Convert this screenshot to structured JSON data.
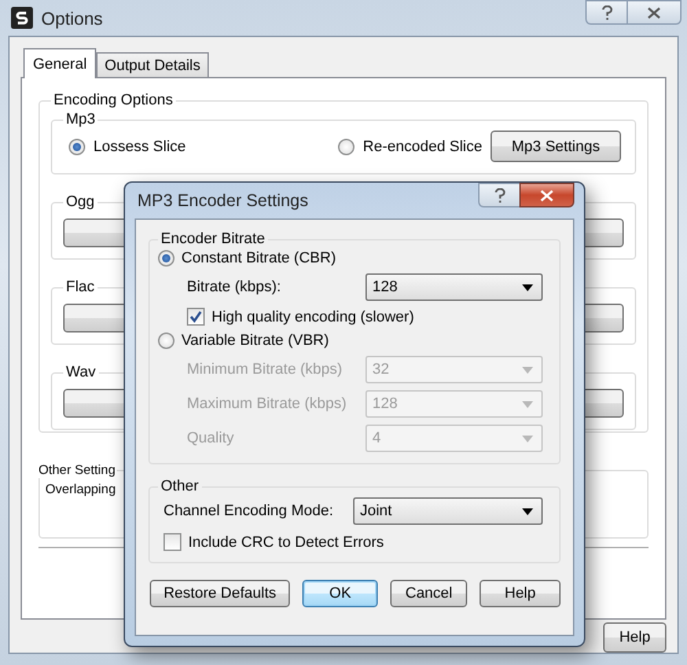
{
  "window": {
    "title": "Options"
  },
  "tabs": [
    {
      "label": "General",
      "selected": true
    },
    {
      "label": "Output Details",
      "selected": false
    }
  ],
  "encoding_options": {
    "title": "Encoding Options",
    "mp3": {
      "title": "Mp3",
      "options": [
        {
          "label": "Lossess Slice",
          "selected": true
        },
        {
          "label": "Re-encoded Slice",
          "selected": false
        }
      ],
      "button": "Mp3 Settings"
    },
    "groups": [
      {
        "title": "Ogg"
      },
      {
        "title": "Flac"
      },
      {
        "title": "Wav"
      }
    ]
  },
  "other_settings": {
    "title": "Other Setting",
    "label": "Overlapping"
  },
  "buttons": [
    "Help"
  ],
  "dialog": {
    "title": "MP3 Encoder Settings",
    "encoder_bitrate": {
      "title": "Encoder Bitrate",
      "modes": [
        {
          "label": "Constant Bitrate (CBR)",
          "selected": true
        },
        {
          "label": "Variable Bitrate (VBR)",
          "selected": false
        }
      ],
      "bitrate": {
        "label": "Bitrate (kbps):",
        "value": "128"
      },
      "high_quality": {
        "label": "High quality encoding (slower)",
        "checked": true
      },
      "vbr_fields": [
        {
          "label": "Minimum Bitrate (kbps)",
          "value": "32",
          "disabled": true
        },
        {
          "label": "Maximum Bitrate (kbps)",
          "value": "128",
          "disabled": true
        },
        {
          "label": "Quality",
          "value": "4",
          "disabled": true
        }
      ]
    },
    "other": {
      "title": "Other",
      "channel_mode": {
        "label": "Channel Encoding Mode:",
        "value": "Joint"
      },
      "crc": {
        "label": "Include CRC to Detect Errors",
        "checked": false
      }
    },
    "buttons": [
      {
        "label": "Restore Defaults",
        "focused": false
      },
      {
        "label": "OK",
        "focused": true
      },
      {
        "label": "Cancel",
        "focused": false
      },
      {
        "label": "Help",
        "focused": false
      }
    ]
  }
}
